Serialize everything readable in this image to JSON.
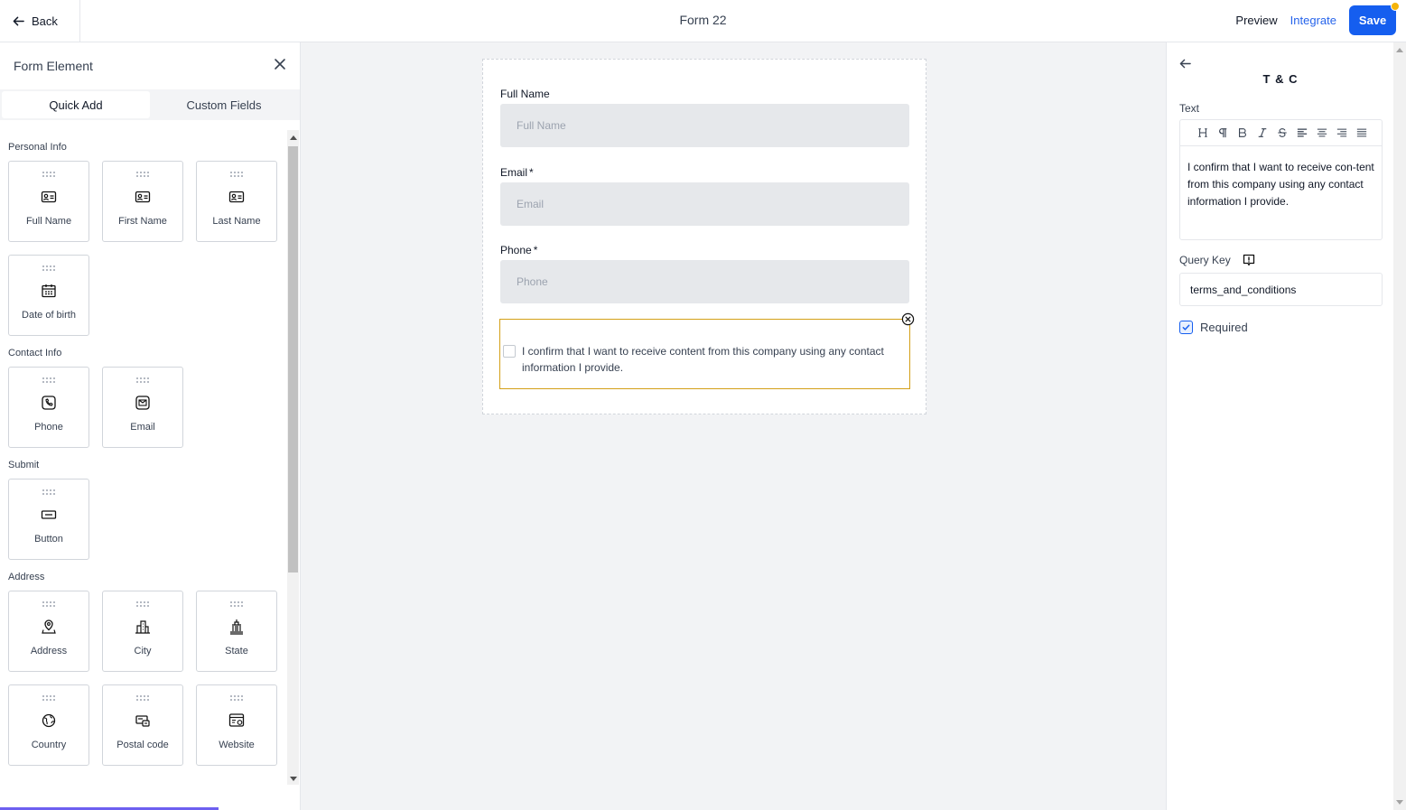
{
  "topbar": {
    "back_label": "Back",
    "form_title": "Form 22",
    "preview_label": "Preview",
    "integrate_label": "Integrate",
    "save_label": "Save"
  },
  "left_panel": {
    "title": "Form Element",
    "tabs": [
      {
        "label": "Quick Add",
        "active": true
      },
      {
        "label": "Custom Fields",
        "active": false
      }
    ],
    "sections": [
      {
        "label": "Personal Info",
        "items": [
          {
            "label": "Full Name",
            "icon": "id-card-icon"
          },
          {
            "label": "First Name",
            "icon": "id-card-icon"
          },
          {
            "label": "Last Name",
            "icon": "id-card-icon"
          },
          {
            "label": "Date of birth",
            "icon": "calendar-icon"
          }
        ]
      },
      {
        "label": "Contact Info",
        "items": [
          {
            "label": "Phone",
            "icon": "phone-icon"
          },
          {
            "label": "Email",
            "icon": "mail-icon"
          }
        ]
      },
      {
        "label": "Submit",
        "items": [
          {
            "label": "Button",
            "icon": "button-icon"
          }
        ]
      },
      {
        "label": "Address",
        "items": [
          {
            "label": "Address",
            "icon": "map-pin-icon"
          },
          {
            "label": "City",
            "icon": "buildings-icon"
          },
          {
            "label": "State",
            "icon": "landmark-icon"
          },
          {
            "label": "Country",
            "icon": "globe-icon"
          },
          {
            "label": "Postal code",
            "icon": "mailbox-icon"
          },
          {
            "label": "Website",
            "icon": "browser-icon"
          }
        ]
      }
    ]
  },
  "form": {
    "fields": [
      {
        "label": "Full Name",
        "required": false,
        "placeholder": "Full Name"
      },
      {
        "label": "Email",
        "required": true,
        "placeholder": "Email"
      },
      {
        "label": "Phone",
        "required": true,
        "placeholder": "Phone"
      }
    ],
    "required_marker": "*",
    "terms_text": "I confirm that I want to receive content from this company using any contact information I provide."
  },
  "right_panel": {
    "title": "T & C",
    "text_label": "Text",
    "toolbar": [
      "heading",
      "paragraph",
      "bold",
      "italic",
      "strikethrough",
      "align-left",
      "align-center",
      "align-right",
      "align-justify"
    ],
    "editor_text": "I confirm that I want to receive con-tent from this company using any contact information I provide.",
    "query_key_label": "Query Key",
    "query_key_value": "terms_and_conditions",
    "required_label": "Required",
    "required_checked": true
  },
  "colors": {
    "accent": "#155eef",
    "integrate": "#2563eb",
    "selected_border": "#d4a017",
    "notification_dot": "#f5b40b",
    "canvas_bg": "#f2f3f5",
    "input_bg": "#e6e8eb"
  }
}
